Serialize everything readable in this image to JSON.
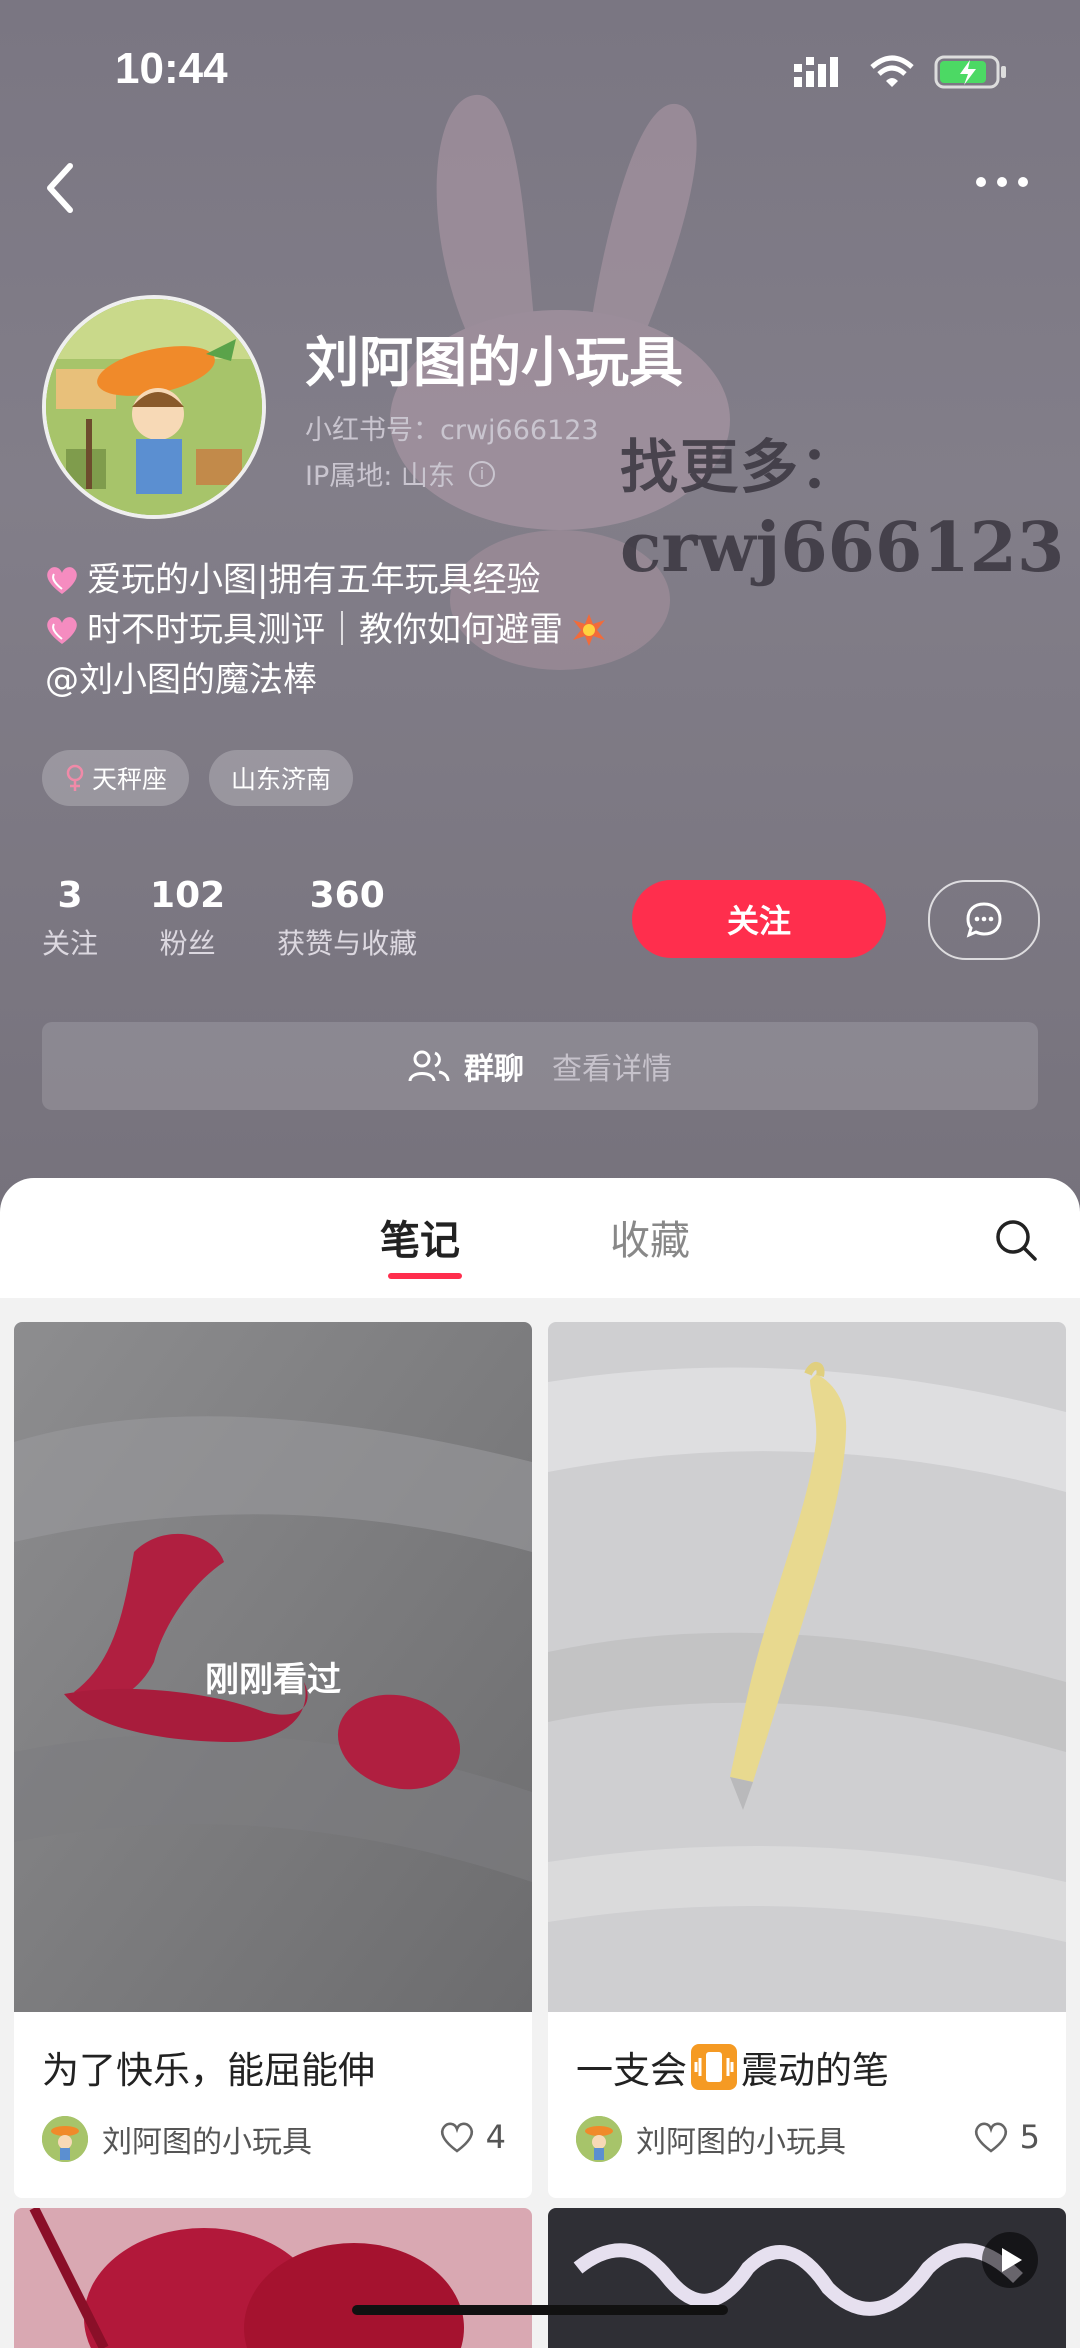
{
  "status_bar": {
    "time": "10:44"
  },
  "profile": {
    "name": "刘阿图的小玩具",
    "xhs_id": "小红书号：crwj666123",
    "ip_location": "IP属地: 山东",
    "watermark_line1": "找更多：",
    "watermark_line2": "crwj666123",
    "bio": [
      "爱玩的小图|拥有五年玩具经验",
      "时不时玩具测评｜教你如何避雷",
      "@刘小图的魔法棒"
    ],
    "tags": [
      "天秤座",
      "山东济南"
    ]
  },
  "stats": [
    {
      "num": "3",
      "label": "关注"
    },
    {
      "num": "102",
      "label": "粉丝"
    },
    {
      "num": "360",
      "label": "获赞与收藏"
    }
  ],
  "actions": {
    "follow": "关注"
  },
  "group": {
    "label": "群聊",
    "detail": "查看详情"
  },
  "tabs": {
    "notes": "笔记",
    "collections": "收藏"
  },
  "notes": [
    {
      "title": "为了快乐，能屈能伸",
      "author": "刘阿图的小玩具",
      "likes": "4",
      "overlay": "刚刚看过"
    },
    {
      "title_a": "一支会",
      "title_b": "震动的笔",
      "author": "刘阿图的小玩具",
      "likes": "5"
    }
  ],
  "colors": {
    "accent": "#ff2e4d",
    "header_bg": "#7d7985"
  }
}
